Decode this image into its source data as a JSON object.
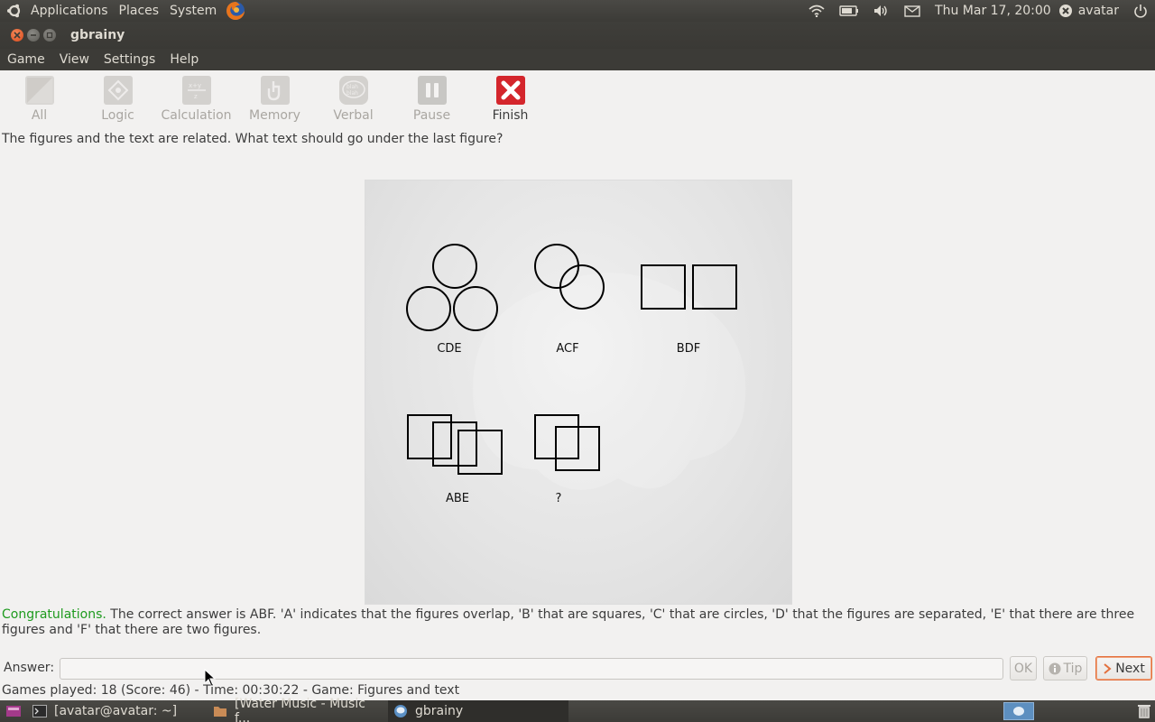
{
  "top_panel": {
    "menus": [
      "Applications",
      "Places",
      "System"
    ],
    "clock": "Thu Mar 17, 20:00",
    "user": "avatar",
    "icons": [
      "wifi-icon",
      "battery-icon",
      "volume-icon",
      "mail-icon",
      "user-status-icon",
      "power-icon"
    ]
  },
  "window": {
    "title": "gbrainy"
  },
  "menubar": [
    "Game",
    "View",
    "Settings",
    "Help"
  ],
  "toolbar": [
    {
      "label": "All",
      "icon": "all-games-icon",
      "enabled": false
    },
    {
      "label": "Logic",
      "icon": "logic-icon",
      "enabled": false
    },
    {
      "label": "Calculation",
      "icon": "calculation-icon",
      "enabled": false
    },
    {
      "label": "Memory",
      "icon": "memory-icon",
      "enabled": false
    },
    {
      "label": "Verbal",
      "icon": "verbal-icon",
      "enabled": false
    },
    {
      "label": "Pause",
      "icon": "pause-icon",
      "enabled": false
    },
    {
      "label": "Finish",
      "icon": "finish-icon",
      "enabled": true
    }
  ],
  "question": "The figures and the text are related. What text should go under the last figure?",
  "puzzle": {
    "labels": [
      "CDE",
      "ACF",
      "BDF",
      "ABE",
      "?"
    ]
  },
  "result": {
    "congrats": "Congratulations.",
    "text": " The correct answer is ABF. 'A' indicates that the figures overlap, 'B' that are squares, 'C' that are circles, 'D' that the figures are separated, 'E' that there are three figures and 'F' that there are two figures."
  },
  "answer": {
    "label": "Answer:",
    "value": "",
    "ok": "OK",
    "tip": "Tip",
    "next": "Next"
  },
  "status": "Games played: 18 (Score: 46) - Time: 00:30:22 - Game: Figures and text",
  "taskbar": [
    {
      "label": "[avatar@avatar: ~]",
      "icon": "terminal-icon"
    },
    {
      "label": "[Water Music - Music f...",
      "icon": "folder-icon"
    },
    {
      "label": "gbrainy",
      "icon": "gbrainy-icon"
    }
  ]
}
